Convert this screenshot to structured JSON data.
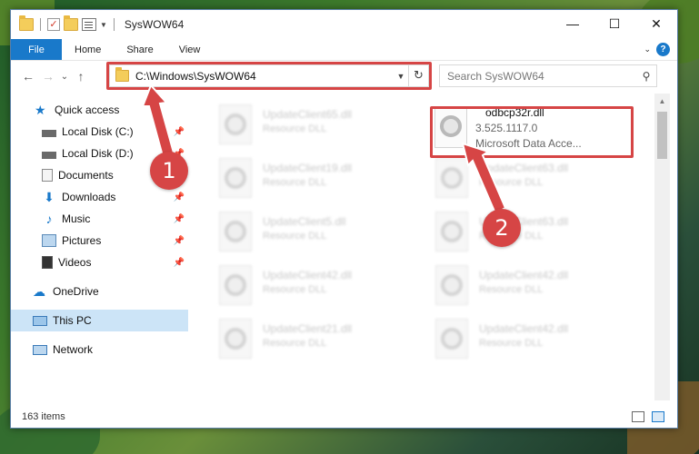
{
  "window": {
    "title": "SysWOW64",
    "controls": {
      "minimize": "—",
      "maximize": "☐",
      "close": "✕"
    }
  },
  "ribbon": {
    "tabs": [
      {
        "label": "File"
      },
      {
        "label": "Home"
      },
      {
        "label": "Share"
      },
      {
        "label": "View"
      }
    ],
    "help_label": "?"
  },
  "address_bar": {
    "path": "C:\\Windows\\SysWOW64",
    "refresh_glyph": "↻"
  },
  "search": {
    "placeholder": "Search SysWOW64"
  },
  "nav": {
    "back": "←",
    "forward": "→",
    "recent": "⌄",
    "up": "↑"
  },
  "sidebar": {
    "items": [
      {
        "label": "Quick access"
      },
      {
        "label": "Local Disk (C:)"
      },
      {
        "label": "Local Disk (D:)"
      },
      {
        "label": "Documents"
      },
      {
        "label": "Downloads"
      },
      {
        "label": "Music"
      },
      {
        "label": "Pictures"
      },
      {
        "label": "Videos"
      },
      {
        "label": "OneDrive"
      },
      {
        "label": "This PC"
      },
      {
        "label": "Network"
      }
    ]
  },
  "files": {
    "left_column": [
      {
        "name": "UpdateClient65.dll",
        "type": "Resource DLL"
      },
      {
        "name": "UpdateClient19.dll",
        "type": "Resource DLL"
      },
      {
        "name": "UpdateClient5.dll",
        "type": "Resource DLL"
      },
      {
        "name": "UpdateClient42.dll",
        "type": "Resource DLL"
      },
      {
        "name": "UpdateClient21.dll",
        "type": "Resource DLL"
      }
    ],
    "right_column": [
      {
        "name": "UpdateClient63.dll",
        "type": "Resource DLL"
      },
      {
        "name": "UpdateClient63.dll",
        "type": "Resource DLL"
      },
      {
        "name": "UpdateClient42.dll",
        "type": "Resource DLL"
      },
      {
        "name": "UpdateClient42.dll",
        "type": "Resource DLL"
      }
    ],
    "highlighted": {
      "name": "odbcp32r.dll",
      "version": "3.525.1117.0",
      "type": "Microsoft Data Acce..."
    }
  },
  "status": {
    "item_count": "163 items"
  },
  "callouts": {
    "one": "1",
    "two": "2"
  },
  "colors": {
    "accent": "#1979ca",
    "highlight_red": "#d64545",
    "selected": "#cce4f7"
  }
}
